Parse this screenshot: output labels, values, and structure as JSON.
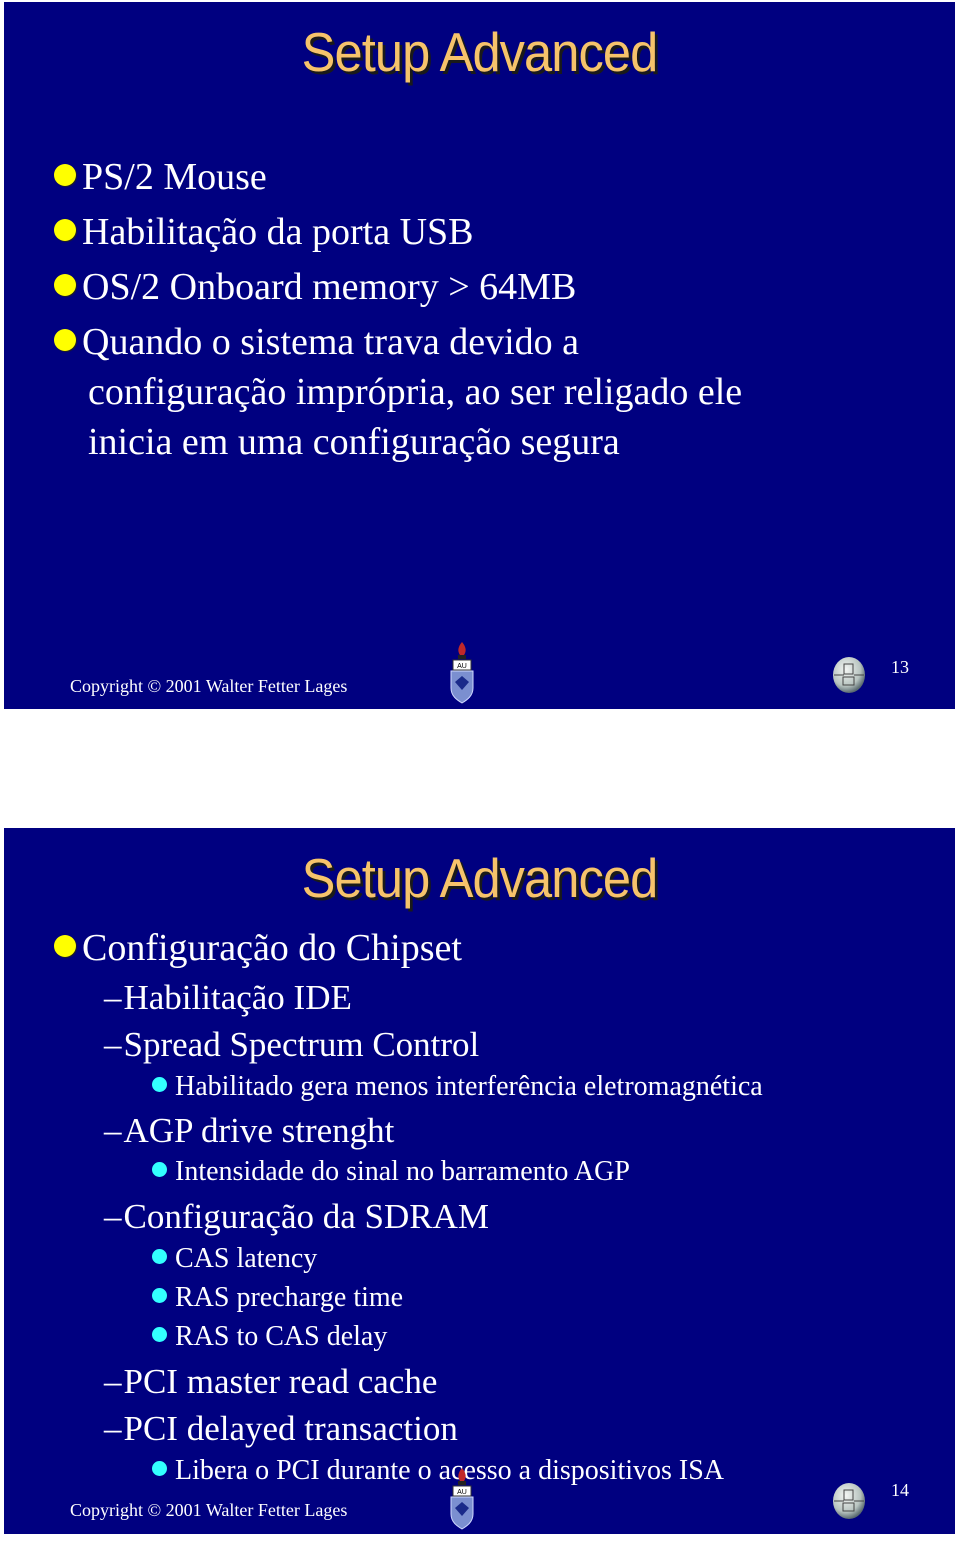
{
  "slides": [
    {
      "number": "13",
      "title": "Setup Advanced",
      "bullets": [
        "PS/2 Mouse",
        "Habilitação da porta USB",
        "OS/2 Onboard memory > 64MB",
        [
          "Quando o sistema trava devido a",
          "configuração imprópria, ao ser religado ele",
          "inicia em uma configuração segura"
        ]
      ],
      "footer": "Copyright © 2001 Walter Fetter Lages"
    },
    {
      "number": "14",
      "title": "Setup Advanced",
      "bullets": [
        {
          "level": 1,
          "text": "Configuração do Chipset"
        },
        {
          "level": 2,
          "text": "Habilitação IDE"
        },
        {
          "level": 2,
          "text": "Spread Spectrum Control"
        },
        {
          "level": 3,
          "text": "Habilitado gera menos interferência eletromagnética"
        },
        {
          "level": 2,
          "text": "AGP drive strenght"
        },
        {
          "level": 3,
          "text": "Intensidade do sinal no barramento AGP"
        },
        {
          "level": 2,
          "text": "Configuração da SDRAM"
        },
        {
          "level": 3,
          "text": "CAS latency"
        },
        {
          "level": 3,
          "text": "RAS precharge time"
        },
        {
          "level": 3,
          "text": "RAS to CAS delay"
        },
        {
          "level": 2,
          "text": "PCI master read cache"
        },
        {
          "level": 2,
          "text": "PCI delayed transaction"
        },
        {
          "level": 3,
          "text": "Libera o PCI durante o acesso a dispositivos ISA"
        }
      ],
      "footer": "Copyright © 2001 Walter Fetter Lages"
    }
  ],
  "icons": {
    "bullet_level1": "yellow-dot",
    "bullet_level2": "en-dash",
    "bullet_level3": "cyan-dot",
    "crest": "university-crest-icon",
    "globe": "globe-logo-icon",
    "dash_glyph": "–"
  },
  "colors": {
    "slide_bg": "#000080",
    "title": "#f6c36b",
    "bullet_l1": "#ffff00",
    "bullet_l3": "#33ffff"
  }
}
